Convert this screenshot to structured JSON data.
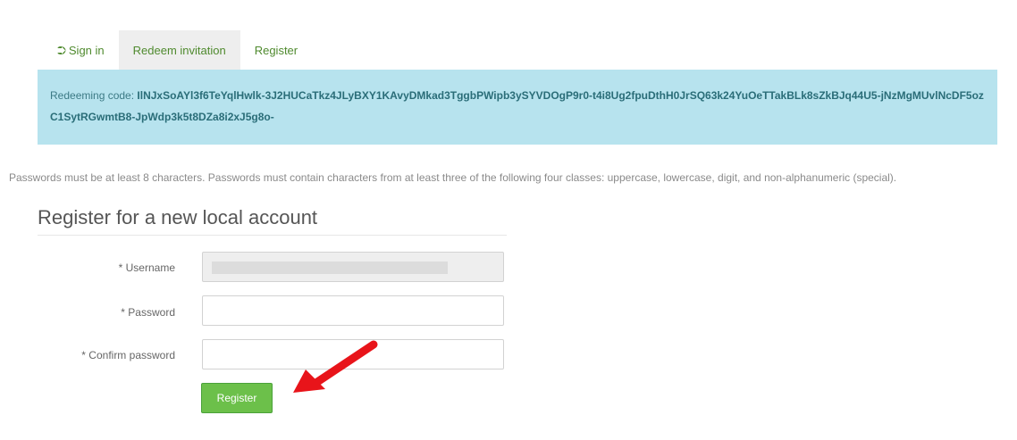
{
  "tabs": [
    {
      "label": "Sign in",
      "icon": "sign-in-icon",
      "active": false
    },
    {
      "label": "Redeem invitation",
      "active": true
    },
    {
      "label": "Register",
      "active": false
    }
  ],
  "banner": {
    "prefix": "Redeeming code: ",
    "code": "IlNJxSoAYl3f6TeYqlHwlk-3J2HUCaTkz4JLyBXY1KAvyDMkad3TggbPWipb3ySYVDOgP9r0-t4i8Ug2fpuDthH0JrSQ63k24YuOeTTakBLk8sZkBJq44U5-jNzMgMUvlNcDF5ozC1SytRGwmtB8-JpWdp3k5t8DZa8i2xJ5g8o-",
    "color": "#b7e3ee"
  },
  "rules": "Passwords must be at least 8 characters. Passwords must contain characters from at least three of the following four classes: uppercase, lowercase, digit, and non-alphanumeric (special).",
  "form": {
    "title": "Register for a new local account",
    "username_label": "* Username",
    "password_label": "* Password",
    "confirm_label": "* Confirm password",
    "register_button": "Register",
    "button_color": "#6cc04a"
  },
  "accent": "#4f8a2e",
  "arrow_color": "#e8141a"
}
